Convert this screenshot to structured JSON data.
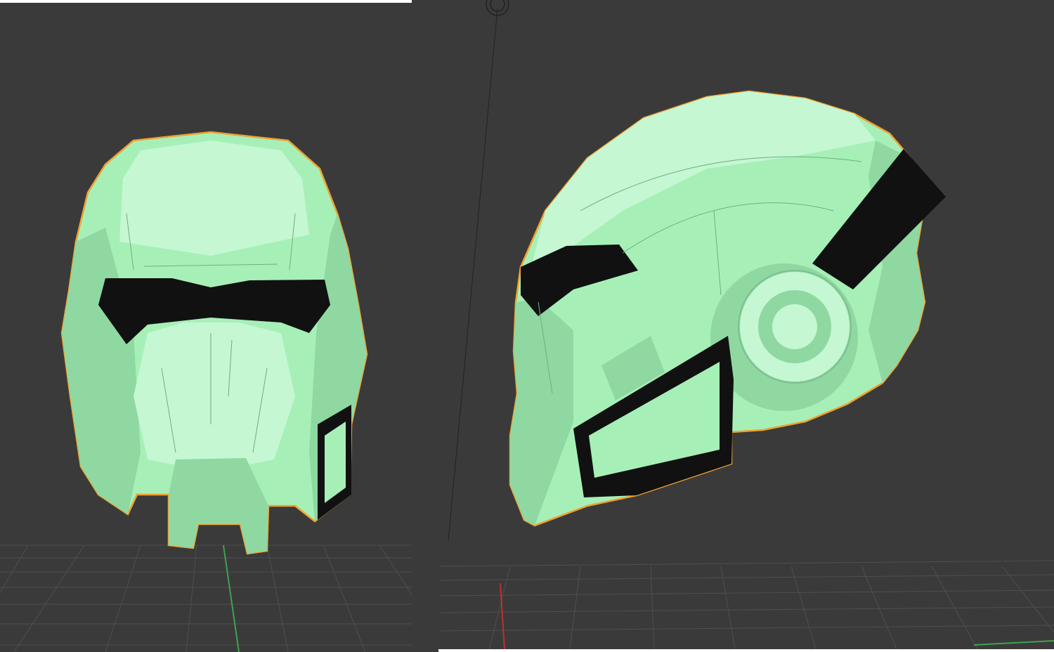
{
  "scene": {
    "background_color": "#3a3a3a",
    "grid_color": "#4f4f4f",
    "model_fill": "#a6f0b8",
    "model_shade": "#8fd8a2",
    "model_highlight": "#c4f7d2",
    "outline_color": "#f0a030",
    "cavity_color": "#111111",
    "y_axis_color": "#3fa34d",
    "x_axis_color": "#c03030"
  },
  "viewports": [
    {
      "view": "front",
      "model": "helmet"
    },
    {
      "view": "side",
      "model": "helmet"
    }
  ]
}
